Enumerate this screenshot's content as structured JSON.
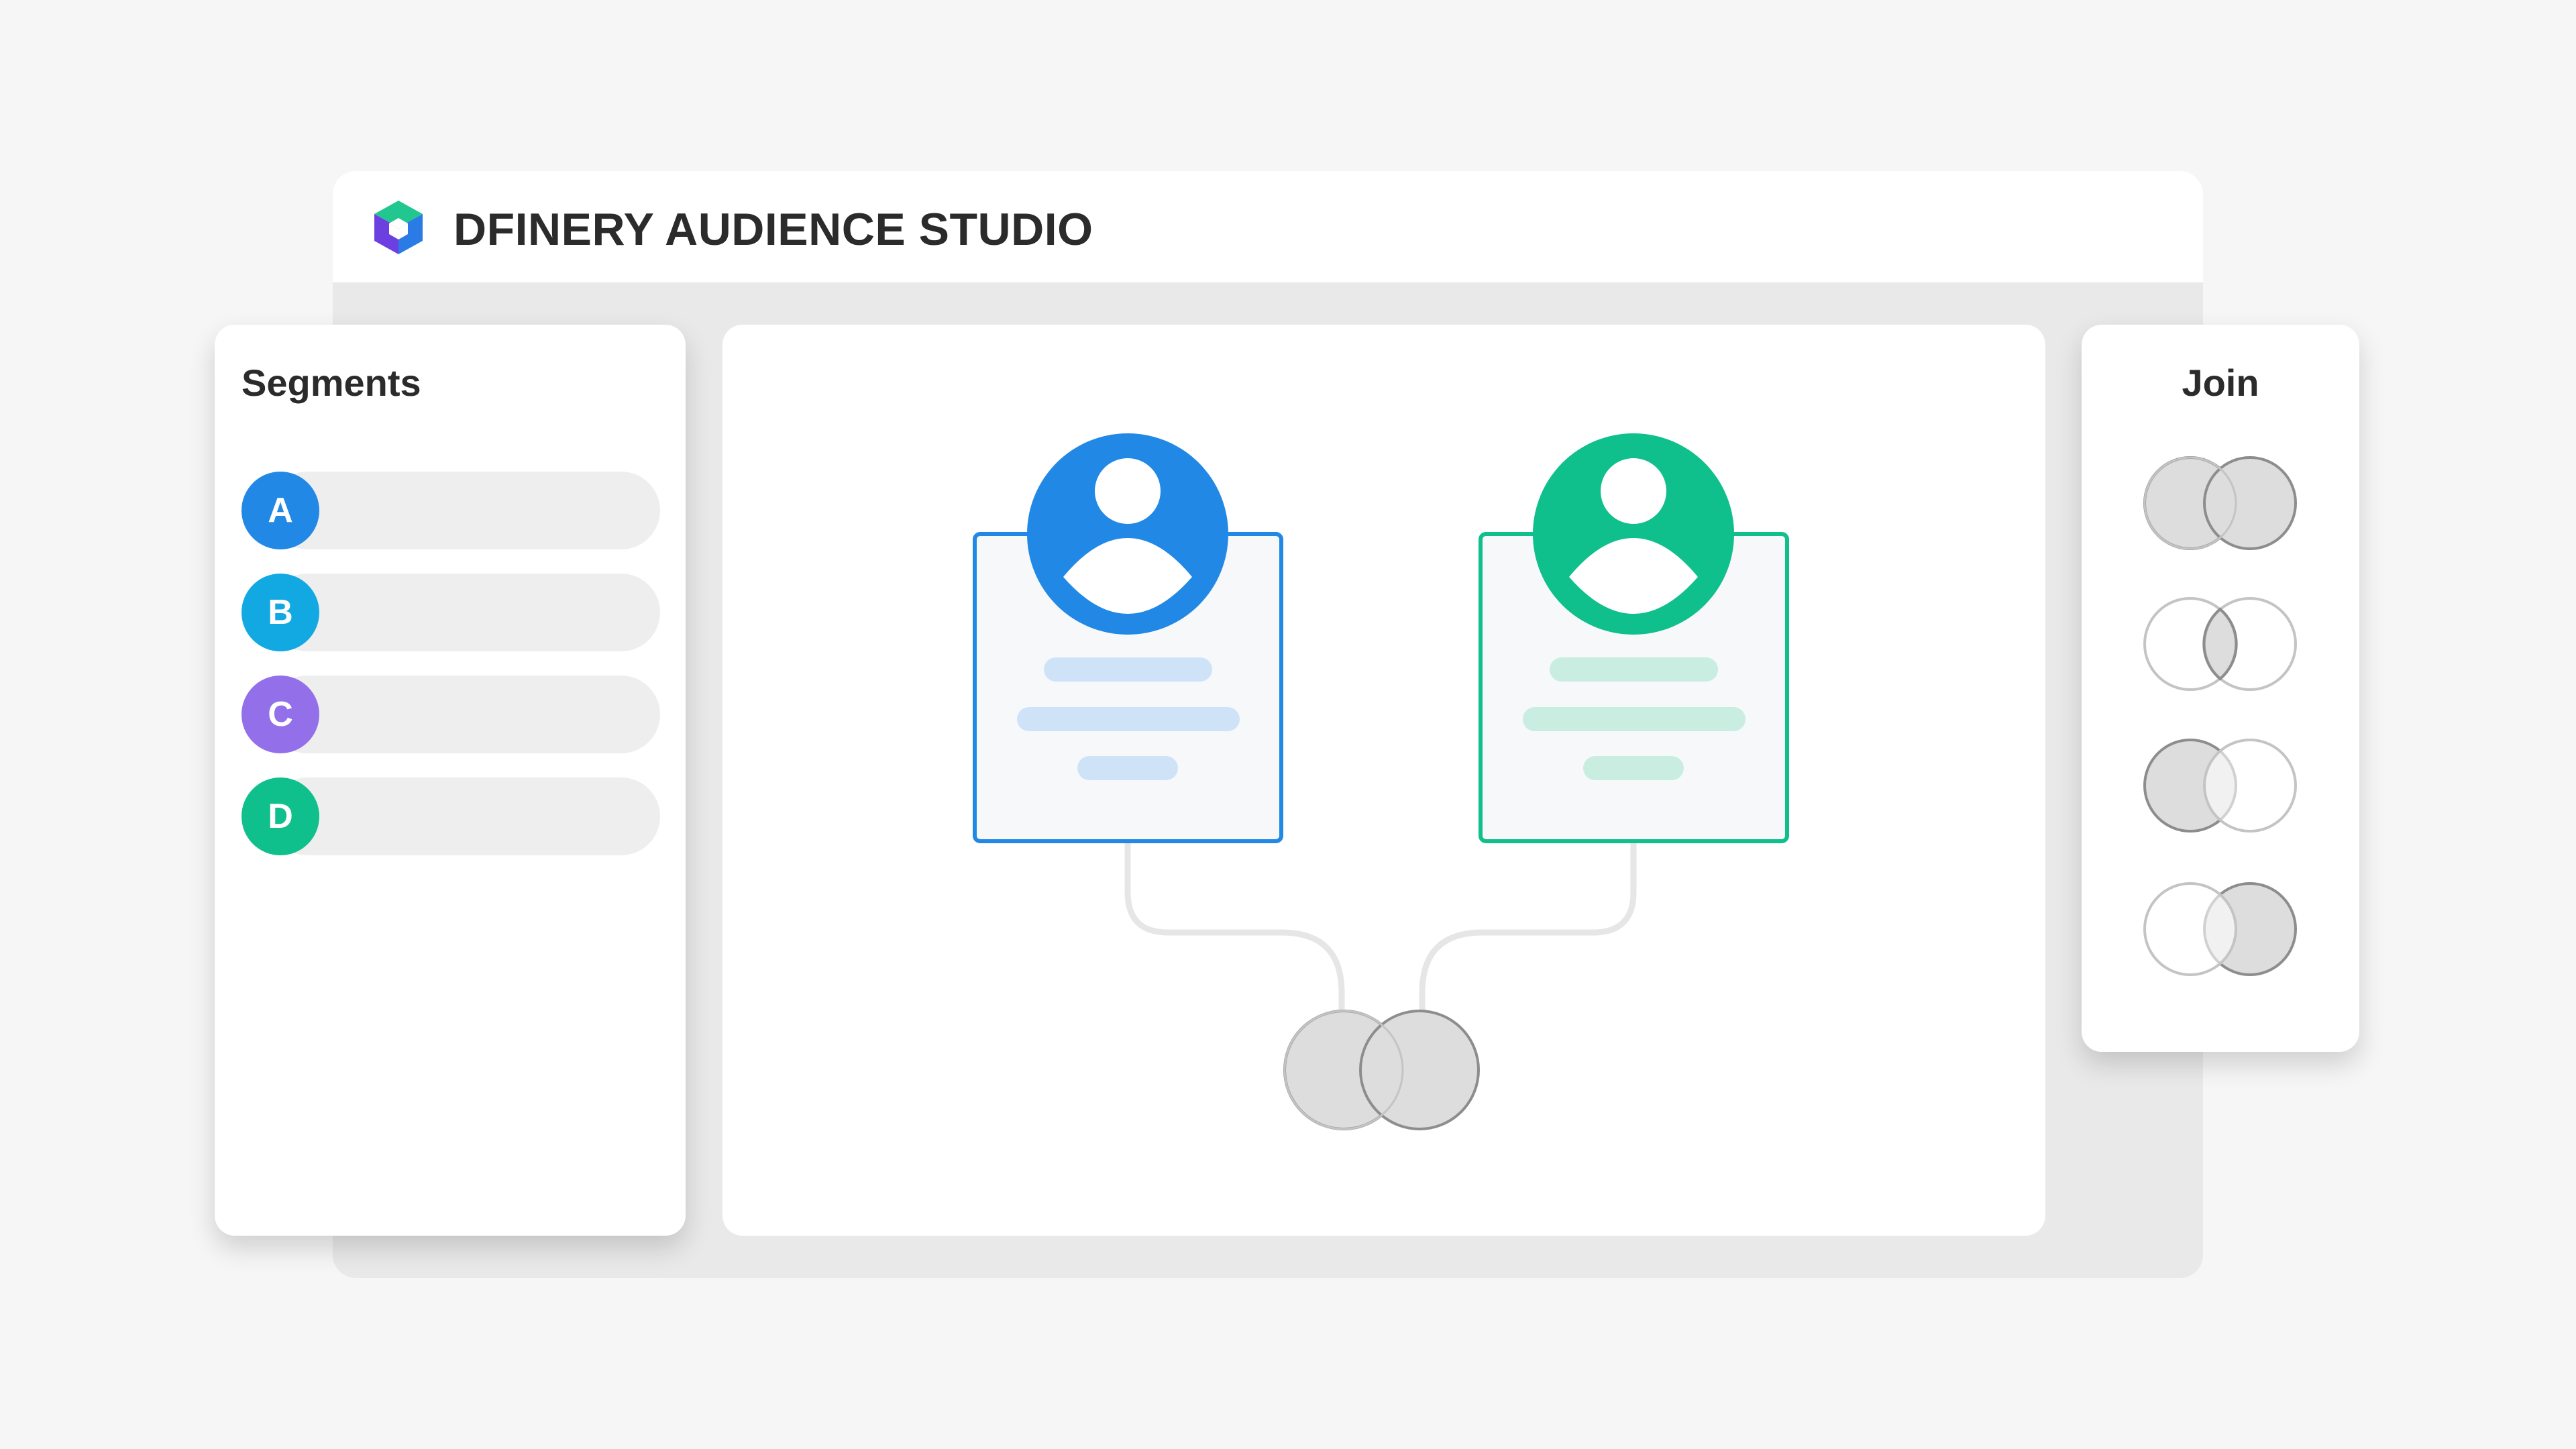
{
  "app": {
    "title": "DFINERY AUDIENCE STUDIO",
    "logo_icon": "cube-logo-icon"
  },
  "segments_panel": {
    "heading": "Segments",
    "items": [
      {
        "label": "A",
        "color": "#2288e6"
      },
      {
        "label": "B",
        "color": "#12a9e3"
      },
      {
        "label": "C",
        "color": "#9370ea"
      },
      {
        "label": "D",
        "color": "#0fbf8c"
      }
    ]
  },
  "canvas": {
    "cards": [
      {
        "icon": "user-avatar-icon",
        "accent": "#2288e6",
        "line_color": "#cfe3f8"
      },
      {
        "icon": "user-avatar-icon",
        "accent": "#0fbf8c",
        "line_color": "#c9ede1"
      }
    ],
    "result_icon": "venn-union-icon"
  },
  "join_panel": {
    "heading": "Join",
    "options": [
      {
        "icon": "venn-union-icon"
      },
      {
        "icon": "venn-intersection-icon"
      },
      {
        "icon": "venn-left-icon"
      },
      {
        "icon": "venn-right-icon"
      }
    ]
  }
}
